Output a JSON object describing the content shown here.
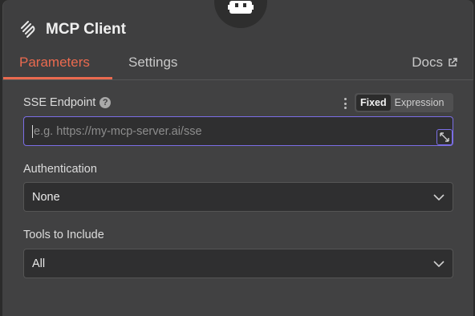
{
  "node": {
    "title": "MCP Client"
  },
  "tabs": {
    "parameters": "Parameters",
    "settings": "Settings",
    "docs": "Docs"
  },
  "sse": {
    "label": "SSE Endpoint",
    "help": "?",
    "mode_fixed": "Fixed",
    "mode_expression": "Expression",
    "placeholder": "e.g. https://my-mcp-server.ai/sse"
  },
  "authentication": {
    "label": "Authentication",
    "value": "None"
  },
  "tools": {
    "label": "Tools to Include",
    "value": "All"
  },
  "colors": {
    "accent": "#ea6a4f",
    "focus": "#7b6ee6"
  }
}
